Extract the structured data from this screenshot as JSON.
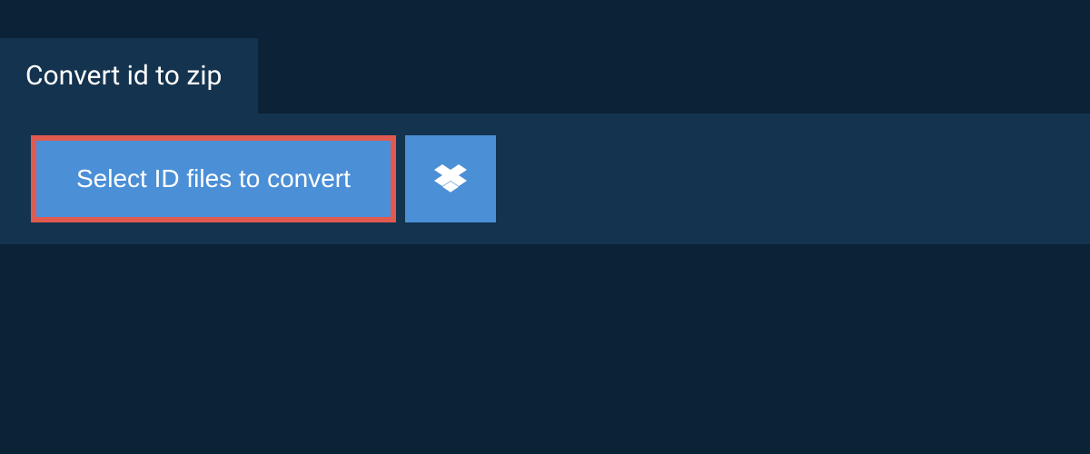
{
  "tab": {
    "title": "Convert id to zip"
  },
  "actions": {
    "select_files_label": "Select ID files to convert"
  }
}
